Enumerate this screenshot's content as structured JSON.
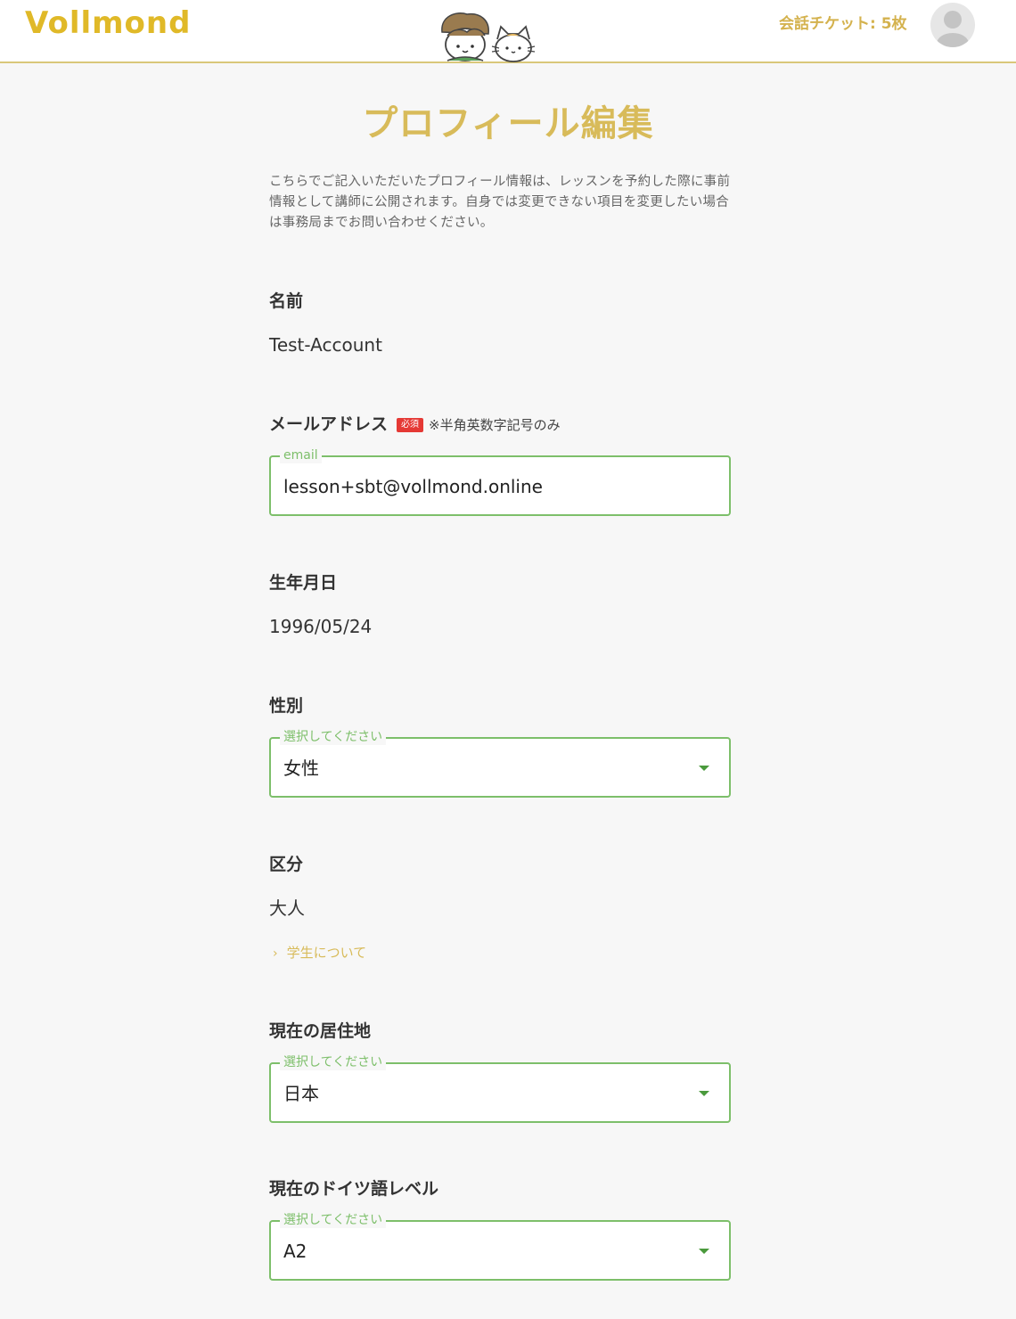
{
  "header": {
    "logo_text": "Vollmond",
    "tickets": "会話チケット: 5枚",
    "brand_color": "#e0b928",
    "accent_color": "#d4b24e"
  },
  "main": {
    "title": "プロフィール編集",
    "intro": "こちらでご記入いただいたプロフィール情報は、レッスンを予約した際に事前情報として講師に公開されます。自身では変更できない項目を変更したい場合は事務局までお問い合わせください。",
    "name": {
      "label": "名前",
      "value": "Test-Account"
    },
    "email": {
      "label": "メールアドレス",
      "required_badge": "必須",
      "note": "※半角英数字記号のみ",
      "legend": "email",
      "value": "lesson+sbt@vollmond.online"
    },
    "birthday": {
      "label": "生年月日",
      "value": "1996/05/24"
    },
    "gender": {
      "label": "性別",
      "legend": "選択してください",
      "value": "女性"
    },
    "category": {
      "label": "区分",
      "value": "大人",
      "link": "学生について"
    },
    "residence": {
      "label": "現在の居住地",
      "legend": "選択してください",
      "value": "日本"
    },
    "german_level": {
      "label": "現在のドイツ語レベル",
      "legend": "選択してください",
      "value": "A2"
    },
    "field_border_color": "#7dbf6a",
    "required_color": "#e53935"
  }
}
